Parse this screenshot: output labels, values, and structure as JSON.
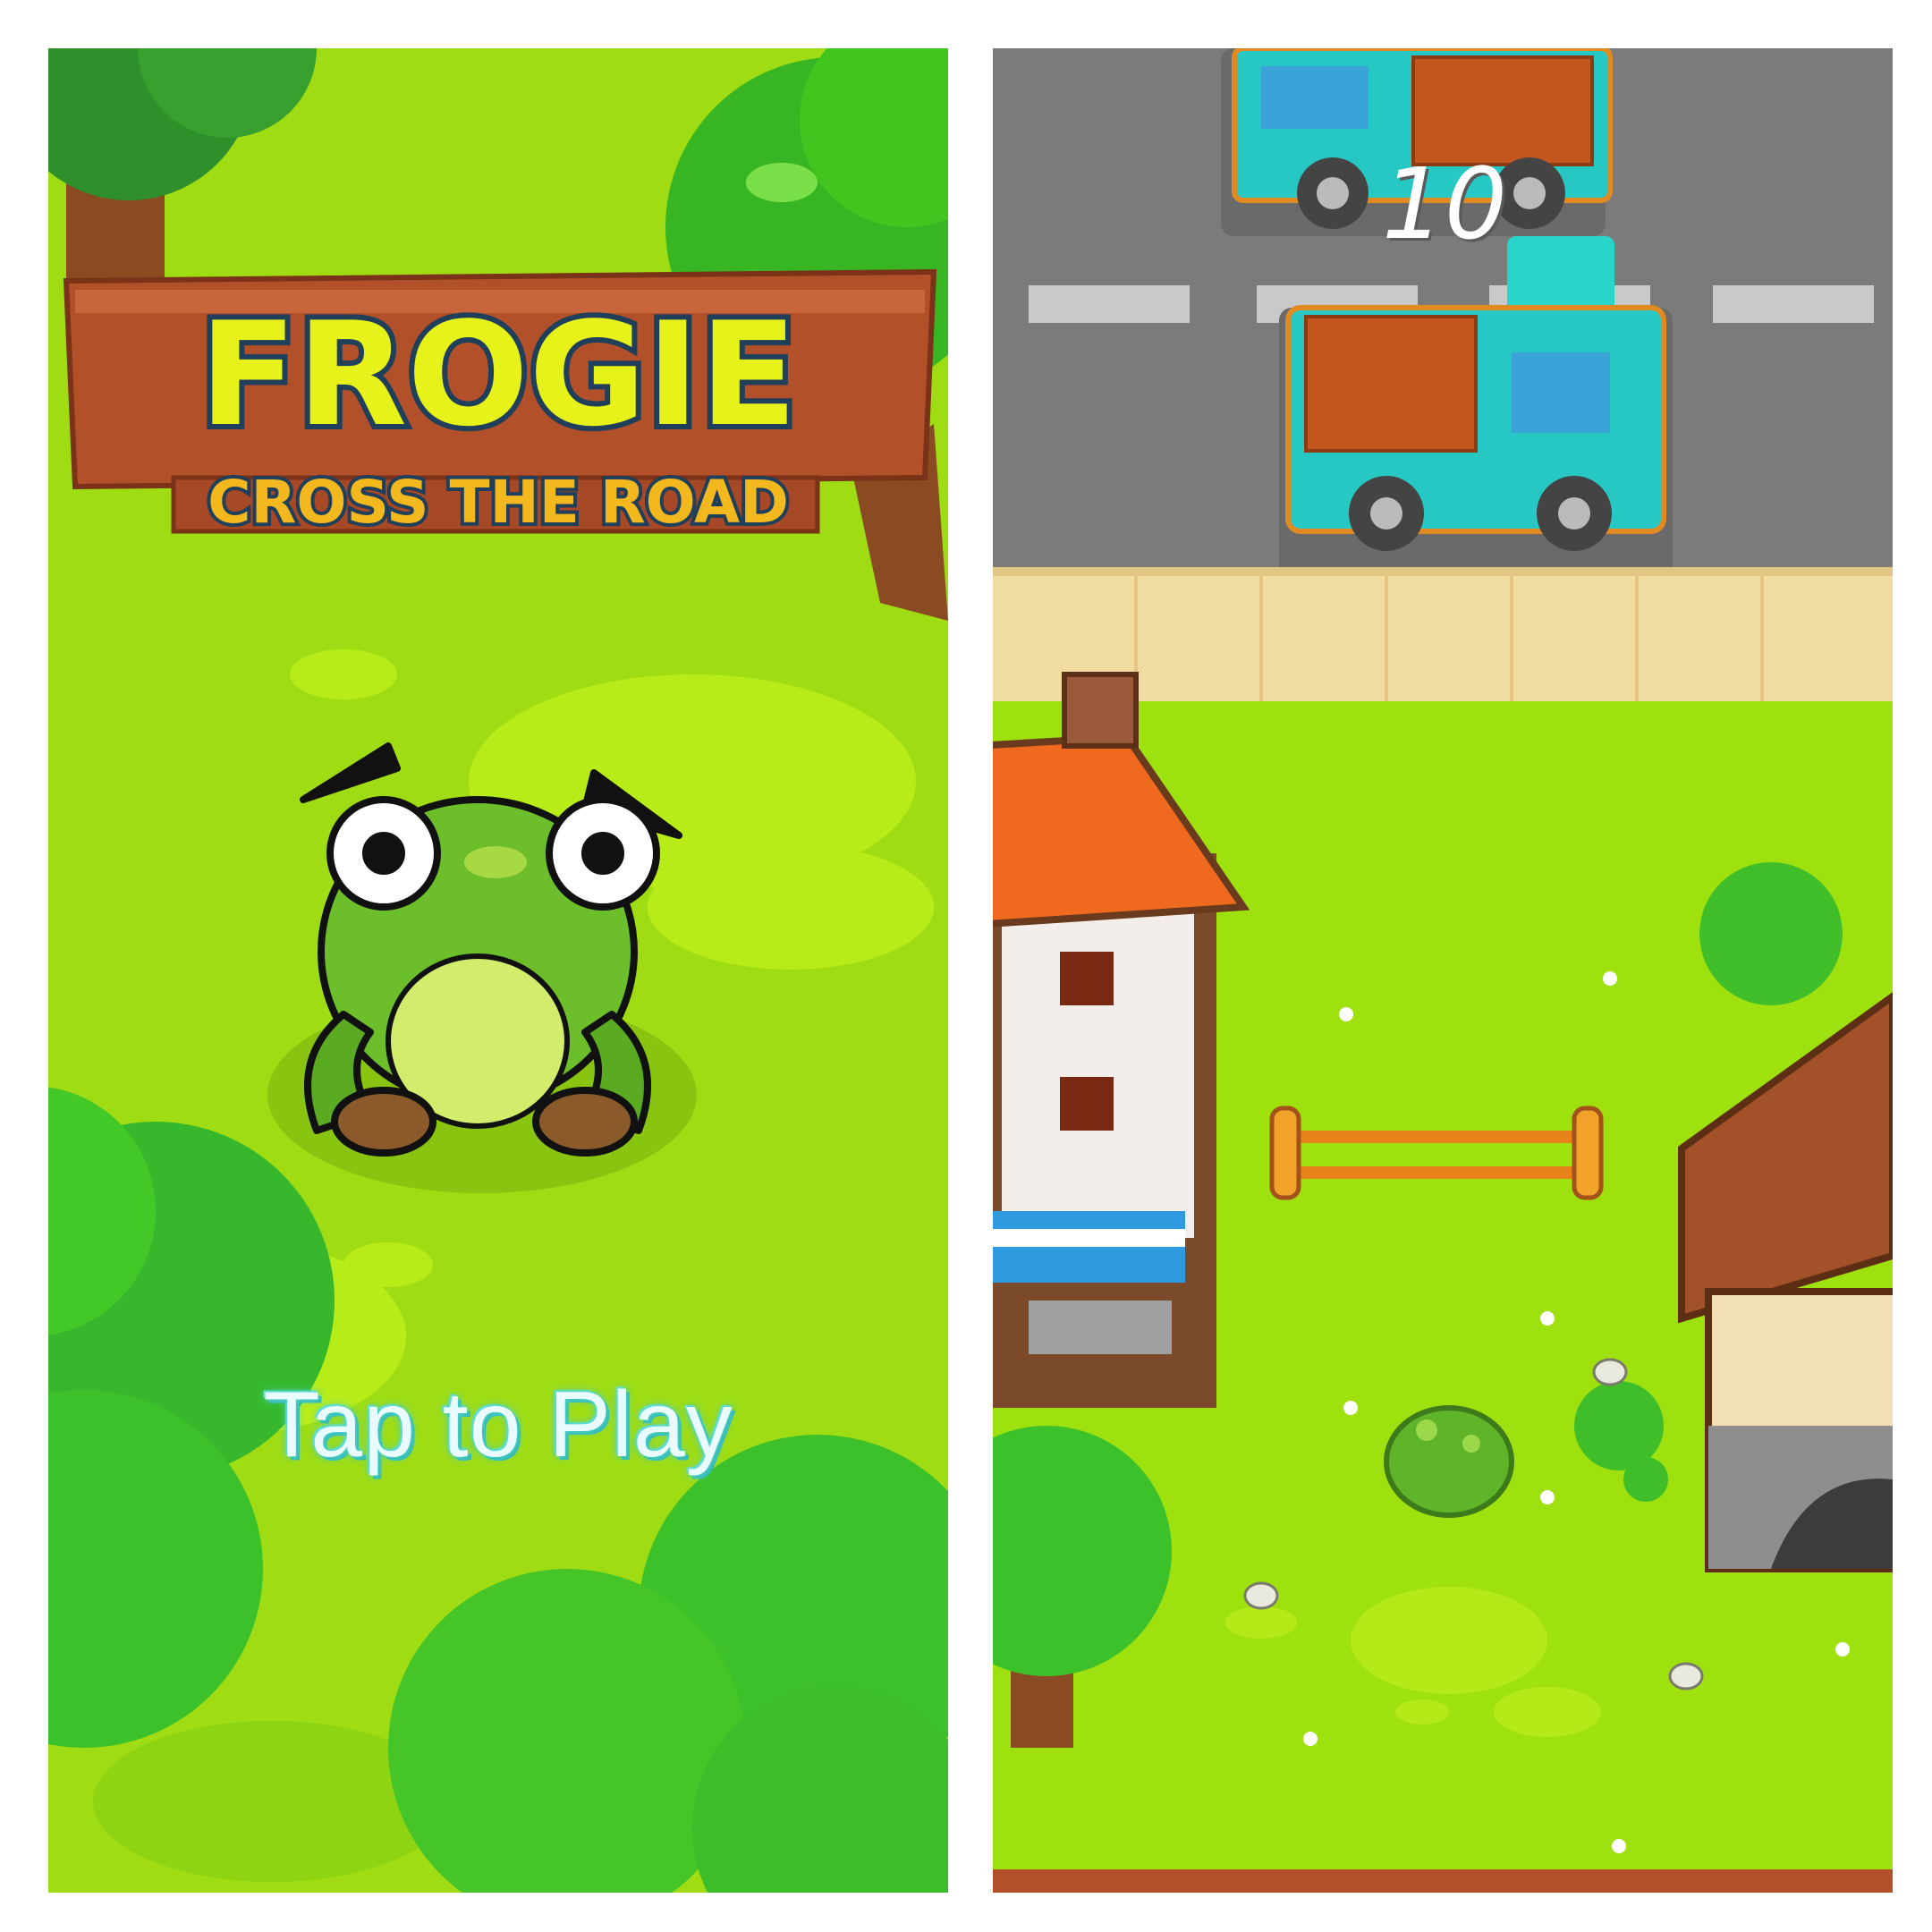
{
  "title_screen": {
    "game_title": "FROGIE",
    "subtitle": "CROSS THE ROAD",
    "cta": "Tap to Play"
  },
  "gameplay": {
    "score": "10"
  },
  "colors": {
    "grass": "#9fdc14",
    "grass_light": "#c4f21e",
    "bush": "#45c51c",
    "title_yellow": "#e6f21a",
    "title_outline": "#1f3f5a",
    "wood": "#b2502a",
    "road": "#7b7b7b",
    "truck_teal": "#27c8c3",
    "truck_cargo": "#c2561d",
    "sidewalk": "#f0dca0",
    "cta_glow": "#46d1c9"
  },
  "icons": [
    "frog-icon",
    "truck-icon",
    "house-icon",
    "fence-icon",
    "tree-icon",
    "bush-icon"
  ]
}
